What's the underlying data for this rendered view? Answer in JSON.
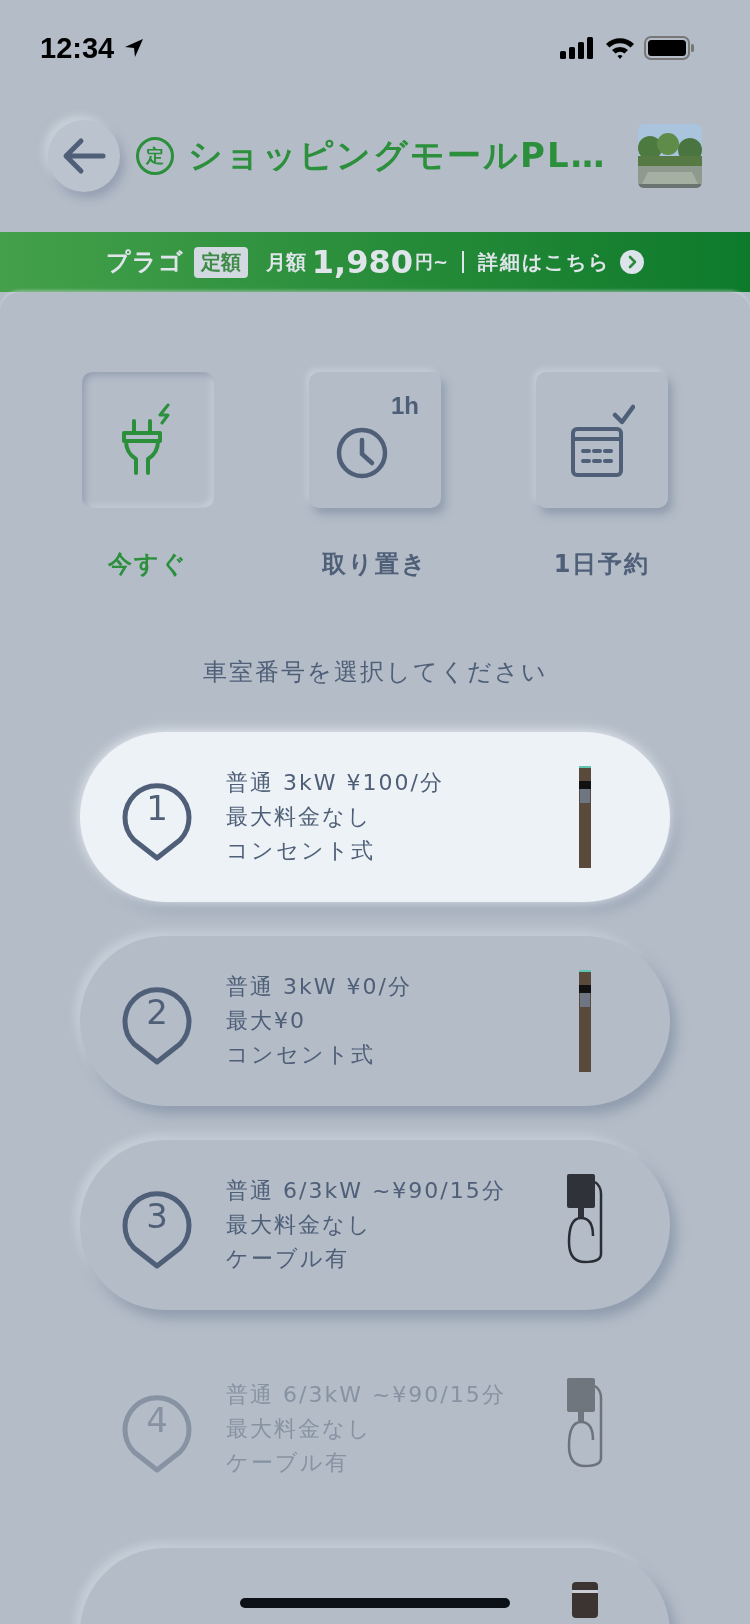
{
  "status_bar": {
    "time": "12:34"
  },
  "header": {
    "badge": "定",
    "title": "ショッピングモールPL…"
  },
  "banner": {
    "brand": "プラゴ",
    "tag": "定額",
    "prefix": "月額",
    "price": "1,980",
    "unit": "円~",
    "link": "詳細はこちら"
  },
  "modes": [
    {
      "kind": "plug",
      "label": "今すぐ",
      "selected": true
    },
    {
      "kind": "clock",
      "label": "取り置き",
      "badge": "1h",
      "selected": false
    },
    {
      "kind": "calendar",
      "label": "1日予約",
      "selected": false
    }
  ],
  "prompt": "車室番号を選択してください",
  "spots": [
    {
      "number": "1",
      "lines": [
        "普通 3kW ¥100/分",
        "最大料金なし",
        "コンセント式"
      ],
      "kind": "pole",
      "selected": true,
      "disabled": false
    },
    {
      "number": "2",
      "lines": [
        "普通 3kW ¥0/分",
        "最大¥0",
        "コンセント式"
      ],
      "kind": "pole",
      "selected": false,
      "disabled": false
    },
    {
      "number": "3",
      "lines": [
        "普通 6/3kW ~¥90/15分",
        "最大料金なし",
        "ケーブル有"
      ],
      "kind": "wallbox",
      "selected": false,
      "disabled": false
    },
    {
      "number": "4",
      "lines": [
        "普通 6/3kW ~¥90/15分",
        "最大料金なし",
        "ケーブル有"
      ],
      "kind": "wallbox",
      "selected": false,
      "disabled": true
    },
    {
      "kind": "box",
      "selected": false,
      "disabled": false
    }
  ]
}
